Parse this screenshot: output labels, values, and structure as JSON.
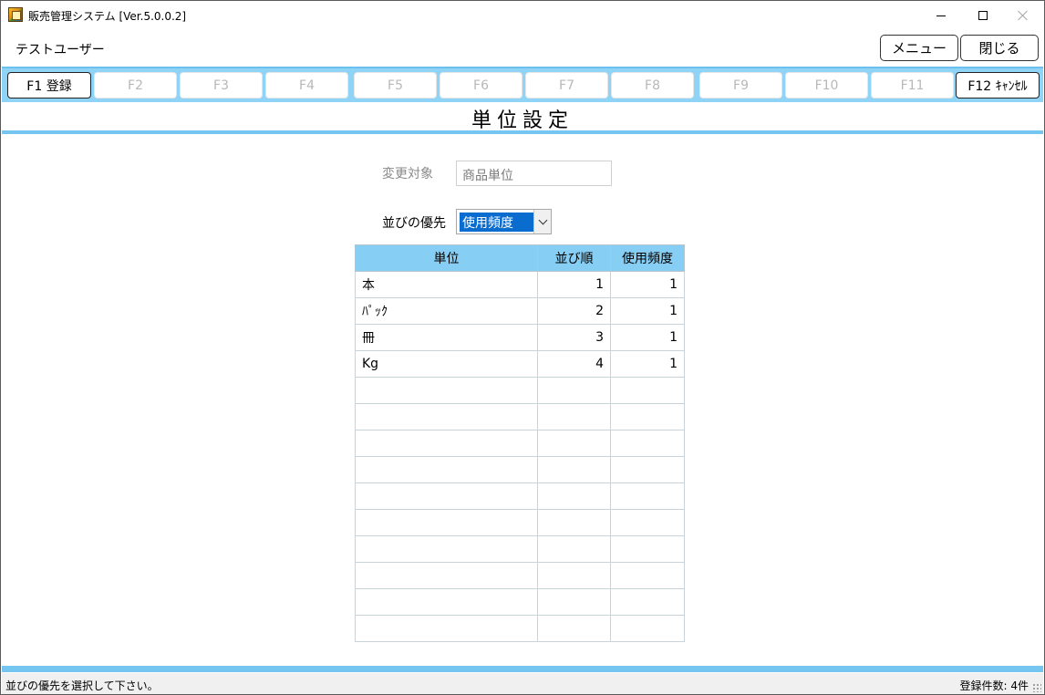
{
  "window": {
    "title": "販売管理システム [Ver.5.0.0.2]"
  },
  "header": {
    "user_name": "テストユーザー",
    "menu_label": "メニュー",
    "close_label": "閉じる"
  },
  "function_keys": [
    {
      "label": "F1 登録",
      "enabled": true
    },
    {
      "label": "F2",
      "enabled": false
    },
    {
      "label": "F3",
      "enabled": false
    },
    {
      "label": "F4",
      "enabled": false
    },
    {
      "label": "F5",
      "enabled": false
    },
    {
      "label": "F6",
      "enabled": false
    },
    {
      "label": "F7",
      "enabled": false
    },
    {
      "label": "F8",
      "enabled": false
    },
    {
      "label": "F9",
      "enabled": false
    },
    {
      "label": "F10",
      "enabled": false
    },
    {
      "label": "F11",
      "enabled": false
    },
    {
      "label": "F12 ｷｬﾝｾﾙ",
      "enabled": true
    }
  ],
  "page": {
    "title": "単位設定"
  },
  "form": {
    "target_label": "変更対象",
    "target_value": "商品単位",
    "order_label": "並びの優先",
    "order_value": "使用頻度"
  },
  "table": {
    "headers": [
      "単位",
      "並び順",
      "使用頻度"
    ],
    "rows": [
      [
        "本",
        "1",
        "1"
      ],
      [
        "ﾊﾟｯｸ",
        "2",
        "1"
      ],
      [
        "冊",
        "3",
        "1"
      ],
      [
        "Kg",
        "4",
        "1"
      ],
      [
        "",
        "",
        ""
      ],
      [
        "",
        "",
        ""
      ],
      [
        "",
        "",
        ""
      ],
      [
        "",
        "",
        ""
      ],
      [
        "",
        "",
        ""
      ],
      [
        "",
        "",
        ""
      ],
      [
        "",
        "",
        ""
      ],
      [
        "",
        "",
        ""
      ],
      [
        "",
        "",
        ""
      ],
      [
        "",
        "",
        ""
      ]
    ]
  },
  "status": {
    "message": "並びの優先を選択して下さい。",
    "count": "登録件数: 4件"
  },
  "colors": {
    "accent": "#74c6f0",
    "fkey_bar": "#8fd3f7",
    "header_cell": "#87cef5",
    "selection": "#0a6ccf"
  }
}
